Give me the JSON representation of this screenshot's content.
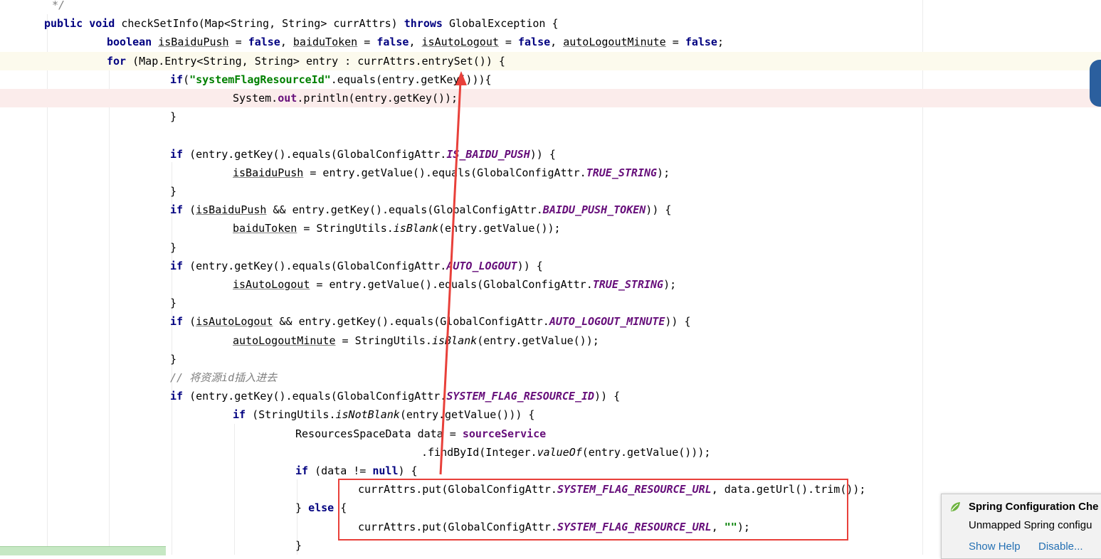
{
  "editor": {
    "lines": [
      {
        "hl": "",
        "indent": 73,
        "tokens": [
          [
            "cmt",
            "*/"
          ]
        ]
      },
      {
        "hl": "",
        "indent": 62,
        "tokens": [
          [
            "kw",
            "public"
          ],
          [
            "plain",
            " "
          ],
          [
            "kw",
            "void"
          ],
          [
            "plain",
            " checkSetInfo(Map<String, String> currAttrs) "
          ],
          [
            "kw",
            "throws"
          ],
          [
            "plain",
            " GlobalException {"
          ]
        ]
      },
      {
        "hl": "",
        "indent": 150,
        "tokens": [
          [
            "kw",
            "boolean"
          ],
          [
            "plain",
            " "
          ],
          [
            "var",
            "isBaiduPush"
          ],
          [
            "plain",
            " = "
          ],
          [
            "kw",
            "false"
          ],
          [
            "plain",
            ", "
          ],
          [
            "var",
            "baiduToken"
          ],
          [
            "plain",
            " = "
          ],
          [
            "kw",
            "false"
          ],
          [
            "plain",
            ", "
          ],
          [
            "var",
            "isAutoLogout"
          ],
          [
            "plain",
            " = "
          ],
          [
            "kw",
            "false"
          ],
          [
            "plain",
            ", "
          ],
          [
            "var",
            "autoLogoutMinute"
          ],
          [
            "plain",
            " = "
          ],
          [
            "kw",
            "false"
          ],
          [
            "plain",
            ";"
          ]
        ]
      },
      {
        "hl": "yellow",
        "indent": 150,
        "tokens": [
          [
            "kw",
            "for"
          ],
          [
            "plain",
            " (Map.Entry<String, String> entry : currAttrs.entrySet()) {"
          ]
        ]
      },
      {
        "hl": "",
        "indent": 239,
        "tokens": [
          [
            "kw",
            "if"
          ],
          [
            "plain",
            "("
          ],
          [
            "str",
            "\"systemFlagResourceId\""
          ],
          [
            "plain",
            ".equals(entry.getKey())){"
          ]
        ]
      },
      {
        "hl": "pink",
        "indent": 327,
        "tokens": [
          [
            "plain",
            "System."
          ],
          [
            "field",
            "out"
          ],
          [
            "plain",
            ".println(entry.getKey());"
          ]
        ]
      },
      {
        "hl": "",
        "indent": 239,
        "tokens": [
          [
            "plain",
            "}"
          ]
        ]
      },
      {
        "hl": "",
        "indent": 239,
        "tokens": []
      },
      {
        "hl": "",
        "indent": 239,
        "tokens": [
          [
            "kw",
            "if"
          ],
          [
            "plain",
            " (entry.getKey().equals(GlobalConfigAttr."
          ],
          [
            "const",
            "IS_BAIDU_PUSH"
          ],
          [
            "plain",
            ")) {"
          ]
        ]
      },
      {
        "hl": "",
        "indent": 327,
        "tokens": [
          [
            "var",
            "isBaiduPush"
          ],
          [
            "plain",
            " = entry.getValue().equals(GlobalConfigAttr."
          ],
          [
            "const",
            "TRUE_STRING"
          ],
          [
            "plain",
            ");"
          ]
        ]
      },
      {
        "hl": "",
        "indent": 239,
        "tokens": [
          [
            "plain",
            "}"
          ]
        ]
      },
      {
        "hl": "",
        "indent": 239,
        "tokens": [
          [
            "kw",
            "if"
          ],
          [
            "plain",
            " ("
          ],
          [
            "var",
            "isBaiduPush"
          ],
          [
            "plain",
            " && entry.getKey().equals(GlobalConfigAttr."
          ],
          [
            "const",
            "BAIDU_PUSH_TOKEN"
          ],
          [
            "plain",
            ")) {"
          ]
        ]
      },
      {
        "hl": "",
        "indent": 327,
        "tokens": [
          [
            "var",
            "baiduToken"
          ],
          [
            "plain",
            " = StringUtils."
          ],
          [
            "static",
            "isBlank"
          ],
          [
            "plain",
            "(entry.getValue());"
          ]
        ]
      },
      {
        "hl": "",
        "indent": 239,
        "tokens": [
          [
            "plain",
            "}"
          ]
        ]
      },
      {
        "hl": "",
        "indent": 239,
        "tokens": [
          [
            "kw",
            "if"
          ],
          [
            "plain",
            " (entry.getKey().equals(GlobalConfigAttr."
          ],
          [
            "const",
            "AUTO_LOGOUT"
          ],
          [
            "plain",
            ")) {"
          ]
        ]
      },
      {
        "hl": "",
        "indent": 327,
        "tokens": [
          [
            "var",
            "isAutoLogout"
          ],
          [
            "plain",
            " = entry.getValue().equals(GlobalConfigAttr."
          ],
          [
            "const",
            "TRUE_STRING"
          ],
          [
            "plain",
            ");"
          ]
        ]
      },
      {
        "hl": "",
        "indent": 239,
        "tokens": [
          [
            "plain",
            "}"
          ]
        ]
      },
      {
        "hl": "",
        "indent": 239,
        "tokens": [
          [
            "kw",
            "if"
          ],
          [
            "plain",
            " ("
          ],
          [
            "var",
            "isAutoLogout"
          ],
          [
            "plain",
            " && entry.getKey().equals(GlobalConfigAttr."
          ],
          [
            "const",
            "AUTO_LOGOUT_MINUTE"
          ],
          [
            "plain",
            ")) {"
          ]
        ]
      },
      {
        "hl": "",
        "indent": 327,
        "tokens": [
          [
            "var",
            "autoLogoutMinute"
          ],
          [
            "plain",
            " = StringUtils."
          ],
          [
            "static",
            "isBlank"
          ],
          [
            "plain",
            "(entry.getValue());"
          ]
        ]
      },
      {
        "hl": "",
        "indent": 239,
        "tokens": [
          [
            "plain",
            "}"
          ]
        ]
      },
      {
        "hl": "",
        "indent": 239,
        "tokens": [
          [
            "cmt",
            "// 将资源id插入进去"
          ]
        ]
      },
      {
        "hl": "",
        "indent": 239,
        "tokens": [
          [
            "kw",
            "if"
          ],
          [
            "plain",
            " (entry.getKey().equals(GlobalConfigAttr."
          ],
          [
            "const",
            "SYSTEM_FLAG_RESOURCE_ID"
          ],
          [
            "plain",
            ")) {"
          ]
        ]
      },
      {
        "hl": "",
        "indent": 327,
        "tokens": [
          [
            "kw",
            "if"
          ],
          [
            "plain",
            " (StringUtils."
          ],
          [
            "static",
            "isNotBlank"
          ],
          [
            "plain",
            "(entry.getValue())) {"
          ]
        ]
      },
      {
        "hl": "",
        "indent": 415,
        "tokens": [
          [
            "plain",
            "ResourcesSpaceData data = "
          ],
          [
            "field",
            "sourceService"
          ]
        ]
      },
      {
        "hl": "",
        "indent": 592,
        "tokens": [
          [
            "plain",
            ".findById(Integer."
          ],
          [
            "static",
            "valueOf"
          ],
          [
            "plain",
            "(entry.getValue()));"
          ]
        ]
      },
      {
        "hl": "",
        "indent": 415,
        "tokens": [
          [
            "kw",
            "if"
          ],
          [
            "plain",
            " (data != "
          ],
          [
            "kw",
            "null"
          ],
          [
            "plain",
            ") {"
          ]
        ]
      },
      {
        "hl": "",
        "indent": 503,
        "tokens": [
          [
            "plain",
            "currAttrs.put(GlobalConfigAttr."
          ],
          [
            "const",
            "SYSTEM_FLAG_RESOURCE_URL"
          ],
          [
            "plain",
            ", data.getUrl().trim());"
          ]
        ]
      },
      {
        "hl": "",
        "indent": 415,
        "tokens": [
          [
            "plain",
            "} "
          ],
          [
            "kw",
            "else"
          ],
          [
            "plain",
            " {"
          ]
        ]
      },
      {
        "hl": "",
        "indent": 503,
        "tokens": [
          [
            "plain",
            "currAttrs.put(GlobalConfigAttr."
          ],
          [
            "const",
            "SYSTEM_FLAG_RESOURCE_URL"
          ],
          [
            "plain",
            ", "
          ],
          [
            "str",
            "\"\""
          ],
          [
            "plain",
            ");"
          ]
        ]
      },
      {
        "hl": "",
        "indent": 415,
        "tokens": [
          [
            "plain",
            "}"
          ]
        ]
      }
    ]
  },
  "notification": {
    "title": "Spring Configuration Che",
    "body": "Unmapped Spring configu",
    "help": "Show Help",
    "disable": "Disable..."
  },
  "colors": {
    "keyword": "#000080",
    "string": "#008000",
    "constant": "#660e7a",
    "annotation_red": "#e8403a",
    "link": "#2470b3"
  }
}
